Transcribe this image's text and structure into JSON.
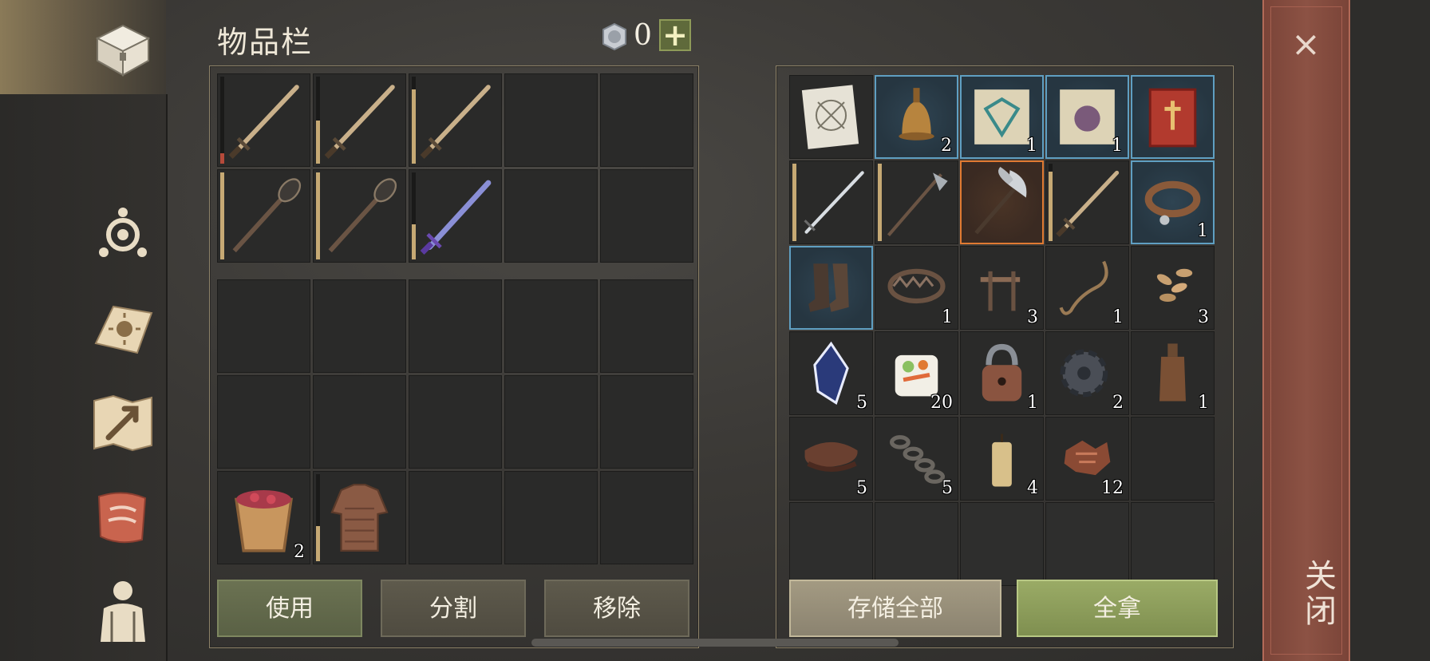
{
  "header": {
    "title": "物品栏",
    "currency_value": "0",
    "add_label": "+"
  },
  "sidebar": {
    "items": [
      {
        "name": "chest-icon",
        "active": true
      },
      {
        "name": "skills-icon"
      },
      {
        "name": "sun-book-icon"
      },
      {
        "name": "map-icon"
      },
      {
        "name": "scroll-icon"
      },
      {
        "name": "character-icon"
      }
    ]
  },
  "inventory": {
    "equip_rows": [
      [
        {
          "item": "sword",
          "dur": 0.12,
          "low": true
        },
        {
          "item": "sword",
          "dur": 0.5
        },
        {
          "item": "sword",
          "dur": 0.85
        },
        {},
        {}
      ],
      [
        {
          "item": "mace",
          "dur": 1.0
        },
        {
          "item": "mace",
          "dur": 1.0
        },
        {
          "item": "blue-sword",
          "dur": 0.4
        },
        {},
        {}
      ]
    ],
    "bag_rows": [
      [
        {},
        {},
        {},
        {},
        {}
      ],
      [
        {},
        {},
        {},
        {},
        {}
      ],
      [
        {
          "item": "berry-bucket",
          "qty": "2"
        },
        {
          "item": "chain-armor",
          "dur": 0.4
        },
        {},
        {},
        {}
      ]
    ]
  },
  "storage": {
    "rows": [
      [
        {
          "item": "blueprint"
        },
        {
          "item": "bell",
          "qty": "2",
          "rare": true
        },
        {
          "item": "blue-scroll",
          "qty": "1",
          "rare": true
        },
        {
          "item": "purple-scroll",
          "qty": "1",
          "rare": true
        },
        {
          "item": "red-book",
          "rare": true
        }
      ],
      [
        {
          "item": "steel-sword",
          "dur": 1.0
        },
        {
          "item": "halberd",
          "dur": 1.0
        },
        {
          "item": "battle-axe",
          "epic": true
        },
        {
          "item": "sword",
          "dur": 0.9
        },
        {
          "item": "collar",
          "qty": "1",
          "rare": true
        }
      ],
      [
        {
          "item": "boots",
          "rare": true
        },
        {
          "item": "bear-trap",
          "qty": "1"
        },
        {
          "item": "nails",
          "qty": "3"
        },
        {
          "item": "rope",
          "qty": "1"
        },
        {
          "item": "seeds",
          "qty": "3"
        }
      ],
      [
        {
          "item": "crystal",
          "qty": "5"
        },
        {
          "item": "sushi",
          "qty": "20"
        },
        {
          "item": "padlock",
          "qty": "1"
        },
        {
          "item": "gear",
          "qty": "2"
        },
        {
          "item": "bottle",
          "qty": "1"
        }
      ],
      [
        {
          "item": "leather",
          "qty": "5"
        },
        {
          "item": "chain",
          "qty": "5"
        },
        {
          "item": "candle",
          "qty": "4"
        },
        {
          "item": "rag-scraps",
          "qty": "12"
        },
        {}
      ],
      [
        {
          "dim": true
        },
        {
          "dim": true
        },
        {
          "dim": true
        },
        {
          "dim": true
        },
        {
          "dim": true
        }
      ]
    ]
  },
  "actions": {
    "use": "使用",
    "split": "分割",
    "remove": "移除",
    "store_all": "存储全部",
    "take_all": "全拿"
  },
  "close": {
    "x": "×",
    "label": "关闭"
  },
  "colors": {
    "rare_border": "#5f9fc2",
    "epic_border": "#e07a32",
    "accent_green": "#9aab66"
  }
}
